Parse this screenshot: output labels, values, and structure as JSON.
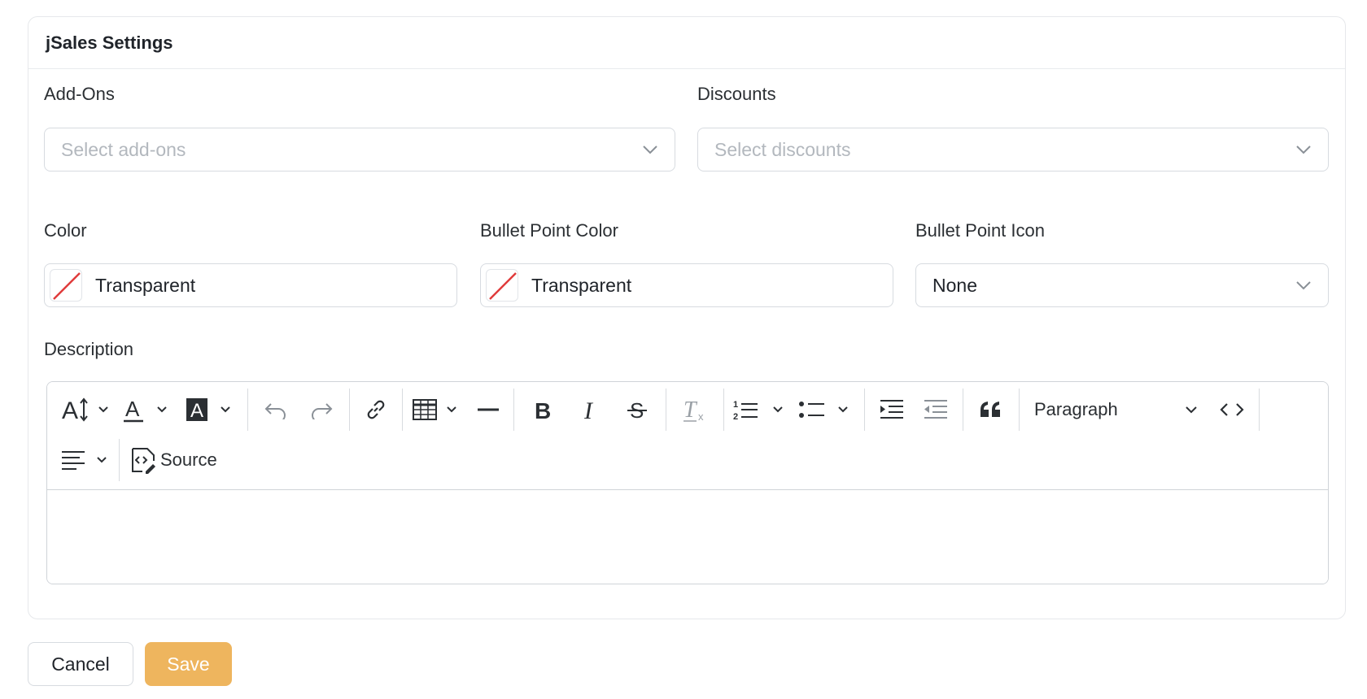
{
  "card": {
    "title": "jSales Settings"
  },
  "addons": {
    "label": "Add-Ons",
    "placeholder": "Select add-ons"
  },
  "discounts": {
    "label": "Discounts",
    "placeholder": "Select discounts"
  },
  "color": {
    "label": "Color",
    "value": "Transparent"
  },
  "bullet_color": {
    "label": "Bullet Point Color",
    "value": "Transparent"
  },
  "bullet_icon": {
    "label": "Bullet Point Icon",
    "value": "None"
  },
  "description": {
    "label": "Description",
    "paragraph_label": "Paragraph",
    "source_label": "Source",
    "toolbar_icons": [
      "font-size-icon",
      "font-color-icon",
      "font-background-color-icon",
      "undo-icon",
      "redo-icon",
      "link-icon",
      "table-icon",
      "horizontal-line-icon",
      "bold-icon",
      "italic-icon",
      "strikethrough-icon",
      "remove-format-icon",
      "numbered-list-icon",
      "bulleted-list-icon",
      "indent-icon",
      "outdent-icon",
      "block-quote-icon",
      "code-icon",
      "align-icon",
      "source-icon"
    ]
  },
  "actions": {
    "cancel": "Cancel",
    "save": "Save"
  },
  "colors": {
    "accent_save": "#eeb55e",
    "transparent_slash": "#e03b3b",
    "border": "#d7dbe0",
    "placeholder": "#b3b8be"
  }
}
